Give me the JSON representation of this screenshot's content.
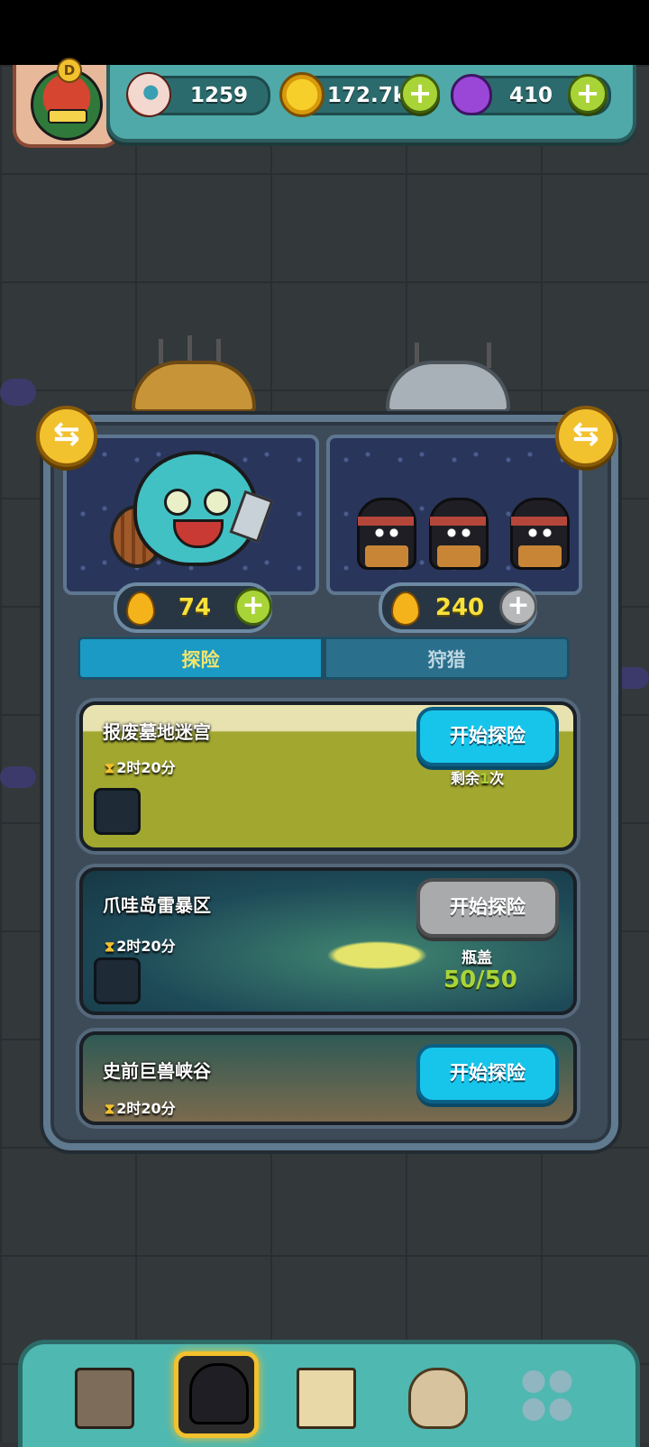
{
  "resources": {
    "eyeballs": "1259",
    "coins": "172.7k",
    "potions": "410"
  },
  "player": {
    "rank": "D"
  },
  "team": {
    "left_energy": "74",
    "right_energy": "240"
  },
  "tabs": [
    "探险",
    "狩猎"
  ],
  "quests": [
    {
      "title": "报废墓地迷宫",
      "time": "2时20分",
      "button": "开始探险",
      "remaining_prefix": "剩余",
      "remaining_count": "1",
      "remaining_suffix": "次",
      "button_state": "enabled"
    },
    {
      "title": "爪哇岛雷暴区",
      "time": "2时20分",
      "button": "开始探险",
      "requirement_label": "瓶盖",
      "requirement_value": "50/50",
      "button_state": "disabled"
    },
    {
      "title": "史前巨兽峡谷",
      "time": "2时20分",
      "button": "开始探险",
      "button_state": "enabled"
    }
  ],
  "icons": {
    "swap": "⇆",
    "plus": "+",
    "hourglass": "⧗"
  },
  "colors": {
    "accent_green": "#a9d437",
    "button_blue": "#17c5ea",
    "energy_yellow": "#f9e13b"
  }
}
